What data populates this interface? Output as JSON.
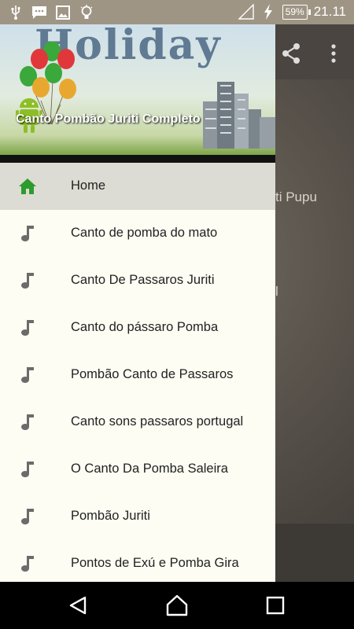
{
  "status_bar": {
    "battery": "59%",
    "time": "21.11",
    "icons": [
      "usb-icon",
      "chat-icon",
      "image-icon",
      "bulb-icon",
      "no-signal-icon",
      "charging-icon"
    ]
  },
  "background_app": {
    "text_1": "ti Pupu",
    "text_2": "l",
    "icons": [
      "share-icon",
      "more-icon"
    ]
  },
  "drawer": {
    "header_banner_text": "Holiday",
    "header_title": "Canto Pombão Juriti Completo",
    "accent_color": "#2e9b2e",
    "items": [
      {
        "label": "Home",
        "icon": "home-icon",
        "active": true
      },
      {
        "label": "Canto de pomba do mato",
        "icon": "music-note-icon"
      },
      {
        "label": "Canto De Passaros Juriti",
        "icon": "music-note-icon"
      },
      {
        "label": "Canto do pássaro Pomba",
        "icon": "music-note-icon"
      },
      {
        "label": "Pombão Canto de Passaros",
        "icon": "music-note-icon"
      },
      {
        "label": "Canto sons passaros portugal",
        "icon": "music-note-icon"
      },
      {
        "label": "O Canto Da Pomba Saleira",
        "icon": "music-note-icon"
      },
      {
        "label": "Pombão Juriti",
        "icon": "music-note-icon"
      },
      {
        "label": "Pontos de Exú e Pomba Gira",
        "icon": "music-note-icon"
      }
    ]
  },
  "nav_bar": {
    "buttons": [
      "back-icon",
      "home-nav-icon",
      "recents-icon"
    ]
  }
}
